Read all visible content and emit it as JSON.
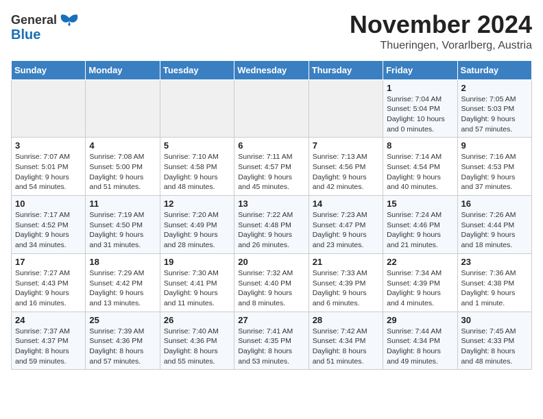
{
  "logo": {
    "line1": "General",
    "line2": "Blue"
  },
  "title": "November 2024",
  "subtitle": "Thueringen, Vorarlberg, Austria",
  "weekdays": [
    "Sunday",
    "Monday",
    "Tuesday",
    "Wednesday",
    "Thursday",
    "Friday",
    "Saturday"
  ],
  "weeks": [
    [
      {
        "day": "",
        "info": ""
      },
      {
        "day": "",
        "info": ""
      },
      {
        "day": "",
        "info": ""
      },
      {
        "day": "",
        "info": ""
      },
      {
        "day": "",
        "info": ""
      },
      {
        "day": "1",
        "info": "Sunrise: 7:04 AM\nSunset: 5:04 PM\nDaylight: 10 hours\nand 0 minutes."
      },
      {
        "day": "2",
        "info": "Sunrise: 7:05 AM\nSunset: 5:03 PM\nDaylight: 9 hours\nand 57 minutes."
      }
    ],
    [
      {
        "day": "3",
        "info": "Sunrise: 7:07 AM\nSunset: 5:01 PM\nDaylight: 9 hours\nand 54 minutes."
      },
      {
        "day": "4",
        "info": "Sunrise: 7:08 AM\nSunset: 5:00 PM\nDaylight: 9 hours\nand 51 minutes."
      },
      {
        "day": "5",
        "info": "Sunrise: 7:10 AM\nSunset: 4:58 PM\nDaylight: 9 hours\nand 48 minutes."
      },
      {
        "day": "6",
        "info": "Sunrise: 7:11 AM\nSunset: 4:57 PM\nDaylight: 9 hours\nand 45 minutes."
      },
      {
        "day": "7",
        "info": "Sunrise: 7:13 AM\nSunset: 4:56 PM\nDaylight: 9 hours\nand 42 minutes."
      },
      {
        "day": "8",
        "info": "Sunrise: 7:14 AM\nSunset: 4:54 PM\nDaylight: 9 hours\nand 40 minutes."
      },
      {
        "day": "9",
        "info": "Sunrise: 7:16 AM\nSunset: 4:53 PM\nDaylight: 9 hours\nand 37 minutes."
      }
    ],
    [
      {
        "day": "10",
        "info": "Sunrise: 7:17 AM\nSunset: 4:52 PM\nDaylight: 9 hours\nand 34 minutes."
      },
      {
        "day": "11",
        "info": "Sunrise: 7:19 AM\nSunset: 4:50 PM\nDaylight: 9 hours\nand 31 minutes."
      },
      {
        "day": "12",
        "info": "Sunrise: 7:20 AM\nSunset: 4:49 PM\nDaylight: 9 hours\nand 28 minutes."
      },
      {
        "day": "13",
        "info": "Sunrise: 7:22 AM\nSunset: 4:48 PM\nDaylight: 9 hours\nand 26 minutes."
      },
      {
        "day": "14",
        "info": "Sunrise: 7:23 AM\nSunset: 4:47 PM\nDaylight: 9 hours\nand 23 minutes."
      },
      {
        "day": "15",
        "info": "Sunrise: 7:24 AM\nSunset: 4:46 PM\nDaylight: 9 hours\nand 21 minutes."
      },
      {
        "day": "16",
        "info": "Sunrise: 7:26 AM\nSunset: 4:44 PM\nDaylight: 9 hours\nand 18 minutes."
      }
    ],
    [
      {
        "day": "17",
        "info": "Sunrise: 7:27 AM\nSunset: 4:43 PM\nDaylight: 9 hours\nand 16 minutes."
      },
      {
        "day": "18",
        "info": "Sunrise: 7:29 AM\nSunset: 4:42 PM\nDaylight: 9 hours\nand 13 minutes."
      },
      {
        "day": "19",
        "info": "Sunrise: 7:30 AM\nSunset: 4:41 PM\nDaylight: 9 hours\nand 11 minutes."
      },
      {
        "day": "20",
        "info": "Sunrise: 7:32 AM\nSunset: 4:40 PM\nDaylight: 9 hours\nand 8 minutes."
      },
      {
        "day": "21",
        "info": "Sunrise: 7:33 AM\nSunset: 4:39 PM\nDaylight: 9 hours\nand 6 minutes."
      },
      {
        "day": "22",
        "info": "Sunrise: 7:34 AM\nSunset: 4:39 PM\nDaylight: 9 hours\nand 4 minutes."
      },
      {
        "day": "23",
        "info": "Sunrise: 7:36 AM\nSunset: 4:38 PM\nDaylight: 9 hours\nand 1 minute."
      }
    ],
    [
      {
        "day": "24",
        "info": "Sunrise: 7:37 AM\nSunset: 4:37 PM\nDaylight: 8 hours\nand 59 minutes."
      },
      {
        "day": "25",
        "info": "Sunrise: 7:39 AM\nSunset: 4:36 PM\nDaylight: 8 hours\nand 57 minutes."
      },
      {
        "day": "26",
        "info": "Sunrise: 7:40 AM\nSunset: 4:36 PM\nDaylight: 8 hours\nand 55 minutes."
      },
      {
        "day": "27",
        "info": "Sunrise: 7:41 AM\nSunset: 4:35 PM\nDaylight: 8 hours\nand 53 minutes."
      },
      {
        "day": "28",
        "info": "Sunrise: 7:42 AM\nSunset: 4:34 PM\nDaylight: 8 hours\nand 51 minutes."
      },
      {
        "day": "29",
        "info": "Sunrise: 7:44 AM\nSunset: 4:34 PM\nDaylight: 8 hours\nand 49 minutes."
      },
      {
        "day": "30",
        "info": "Sunrise: 7:45 AM\nSunset: 4:33 PM\nDaylight: 8 hours\nand 48 minutes."
      }
    ]
  ]
}
